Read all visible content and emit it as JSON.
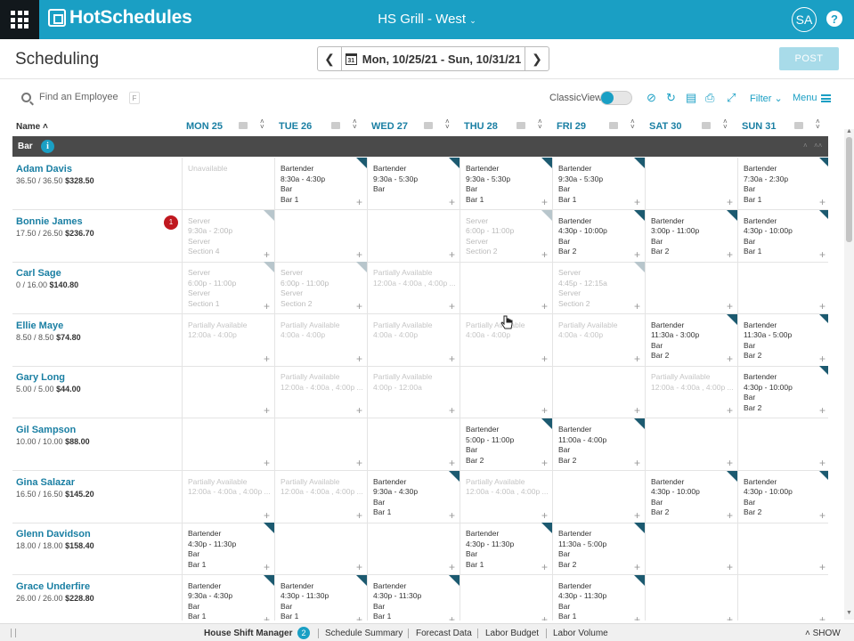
{
  "topbar": {
    "logo": "HotSchedules",
    "location": "HS Grill - West",
    "avatar": "SA",
    "help": "?"
  },
  "page": {
    "title": "Scheduling",
    "date_range": "Mon, 10/25/21 - Sun, 10/31/21",
    "calendar_day": "31",
    "post_label": "POST"
  },
  "toolbar": {
    "search_placeholder": "Find an Employee",
    "search_key": "F",
    "classic_view": "ClassicView",
    "filter": "Filter",
    "menu": "Menu"
  },
  "header": {
    "name": "Name",
    "days": [
      "MON 25",
      "TUE 26",
      "WED 27",
      "THU 28",
      "FRI 29",
      "SAT 30",
      "SUN 31"
    ]
  },
  "group": {
    "name": "Bar",
    "info": "i"
  },
  "employees": [
    {
      "name": "Adam Davis",
      "hours": "36.50 / 36.50",
      "wage": "$328.50",
      "alert": "",
      "cells": [
        {
          "kind": "unav",
          "lines": [
            "Unavailable"
          ]
        },
        {
          "kind": "shift",
          "lines": [
            "Bartender",
            "8:30a - 4:30p",
            "Bar",
            "Bar 1"
          ]
        },
        {
          "kind": "shift",
          "lines": [
            "Bartender",
            "9:30a - 5:30p",
            "Bar"
          ]
        },
        {
          "kind": "shift",
          "lines": [
            "Bartender",
            "9:30a - 5:30p",
            "Bar",
            "Bar 1"
          ]
        },
        {
          "kind": "shift",
          "lines": [
            "Bartender",
            "9:30a - 5:30p",
            "Bar",
            "Bar 1"
          ]
        },
        {
          "kind": "empty",
          "lines": []
        },
        {
          "kind": "shift",
          "lines": [
            "Bartender",
            "7:30a - 2:30p",
            "Bar",
            "Bar 1"
          ]
        }
      ]
    },
    {
      "name": "Bonnie James",
      "hours": "17.50 / 26.50",
      "wage": "$236.70",
      "alert": "1",
      "cells": [
        {
          "kind": "faint",
          "lines": [
            "Server",
            "9:30a - 2:00p",
            "Server",
            "Section 4"
          ]
        },
        {
          "kind": "empty",
          "lines": []
        },
        {
          "kind": "empty",
          "lines": []
        },
        {
          "kind": "faint",
          "lines": [
            "Server",
            "6:00p - 11:00p",
            "Server",
            "Section 2"
          ]
        },
        {
          "kind": "shift",
          "lines": [
            "Bartender",
            "4:30p - 10:00p",
            "Bar",
            "Bar 2"
          ]
        },
        {
          "kind": "shift",
          "lines": [
            "Bartender",
            "3:00p - 11:00p",
            "Bar",
            "Bar 2"
          ]
        },
        {
          "kind": "shift",
          "lines": [
            "Bartender",
            "4:30p - 10:00p",
            "Bar",
            "Bar 1"
          ]
        }
      ]
    },
    {
      "name": "Carl Sage",
      "hours": "0 / 16.00",
      "wage": "$140.80",
      "alert": "",
      "cells": [
        {
          "kind": "faint",
          "lines": [
            "Server",
            "6:00p - 11:00p",
            "Server",
            "Section 1"
          ]
        },
        {
          "kind": "faint",
          "lines": [
            "Server",
            "6:00p - 11:00p",
            "Server",
            "Section 2"
          ]
        },
        {
          "kind": "partial",
          "lines": [
            "Partially Available",
            "12:00a - 4:00a , 4:00p ..."
          ]
        },
        {
          "kind": "empty",
          "lines": []
        },
        {
          "kind": "faint",
          "lines": [
            "Server",
            "4:45p - 12:15a",
            "Server",
            "Section 2"
          ]
        },
        {
          "kind": "empty",
          "lines": []
        },
        {
          "kind": "empty",
          "lines": []
        }
      ]
    },
    {
      "name": "Ellie Maye",
      "hours": "8.50 / 8.50",
      "wage": "$74.80",
      "alert": "",
      "cells": [
        {
          "kind": "partial",
          "lines": [
            "Partially Available",
            "12:00a - 4:00p"
          ]
        },
        {
          "kind": "partial",
          "lines": [
            "Partially Available",
            "4:00a - 4:00p"
          ]
        },
        {
          "kind": "partial",
          "lines": [
            "Partially Available",
            "4:00a - 4:00p"
          ]
        },
        {
          "kind": "partial",
          "lines": [
            "Partially Available",
            "4:00a - 4:00p"
          ]
        },
        {
          "kind": "partial",
          "lines": [
            "Partially Available",
            "4:00a - 4:00p"
          ]
        },
        {
          "kind": "shift",
          "lines": [
            "Bartender",
            "11:30a - 3:00p",
            "Bar",
            "Bar 2"
          ]
        },
        {
          "kind": "shift",
          "lines": [
            "Bartender",
            "11:30a - 5:00p",
            "Bar",
            "Bar 2"
          ]
        }
      ]
    },
    {
      "name": "Gary Long",
      "hours": "5.00 / 5.00",
      "wage": "$44.00",
      "alert": "",
      "cells": [
        {
          "kind": "empty",
          "lines": []
        },
        {
          "kind": "partial",
          "lines": [
            "Partially Available",
            "12:00a - 4:00a , 4:00p ..."
          ]
        },
        {
          "kind": "partial",
          "lines": [
            "Partially Available",
            "4:00p - 12:00a"
          ]
        },
        {
          "kind": "empty",
          "lines": []
        },
        {
          "kind": "empty",
          "lines": []
        },
        {
          "kind": "partial",
          "lines": [
            "Partially Available",
            "12:00a - 4:00a , 4:00p ..."
          ]
        },
        {
          "kind": "shift",
          "lines": [
            "Bartender",
            "4:30p - 10:00p",
            "Bar",
            "Bar 2"
          ]
        }
      ]
    },
    {
      "name": "Gil Sampson",
      "hours": "10.00 / 10.00",
      "wage": "$88.00",
      "alert": "",
      "cells": [
        {
          "kind": "empty",
          "lines": []
        },
        {
          "kind": "empty",
          "lines": []
        },
        {
          "kind": "empty",
          "lines": []
        },
        {
          "kind": "shift",
          "lines": [
            "Bartender",
            "5:00p - 11:00p",
            "Bar",
            "Bar 2"
          ]
        },
        {
          "kind": "shift",
          "lines": [
            "Bartender",
            "11:00a - 4:00p",
            "Bar",
            "Bar 2"
          ]
        },
        {
          "kind": "empty",
          "lines": []
        },
        {
          "kind": "empty",
          "lines": []
        }
      ]
    },
    {
      "name": "Gina Salazar",
      "hours": "16.50 / 16.50",
      "wage": "$145.20",
      "alert": "",
      "cells": [
        {
          "kind": "partial",
          "lines": [
            "Partially Available",
            "12:00a - 4:00a , 4:00p ..."
          ]
        },
        {
          "kind": "partial",
          "lines": [
            "Partially Available",
            "12:00a - 4:00a , 4:00p ..."
          ]
        },
        {
          "kind": "shift",
          "lines": [
            "Bartender",
            "9:30a - 4:30p",
            "Bar",
            "Bar 1"
          ]
        },
        {
          "kind": "partial",
          "lines": [
            "Partially Available",
            "12:00a - 4:00a , 4:00p ..."
          ]
        },
        {
          "kind": "empty",
          "lines": []
        },
        {
          "kind": "shift",
          "lines": [
            "Bartender",
            "4:30p - 10:00p",
            "Bar",
            "Bar 2"
          ]
        },
        {
          "kind": "shift",
          "lines": [
            "Bartender",
            "4:30p - 10:00p",
            "Bar",
            "Bar 2"
          ]
        }
      ]
    },
    {
      "name": "Glenn Davidson",
      "hours": "18.00 / 18.00",
      "wage": "$158.40",
      "alert": "",
      "cells": [
        {
          "kind": "shift",
          "lines": [
            "Bartender",
            "4:30p - 11:30p",
            "Bar",
            "Bar 1"
          ]
        },
        {
          "kind": "empty",
          "lines": []
        },
        {
          "kind": "empty",
          "lines": []
        },
        {
          "kind": "shift",
          "lines": [
            "Bartender",
            "4:30p - 11:30p",
            "Bar",
            "Bar 1"
          ]
        },
        {
          "kind": "shift",
          "lines": [
            "Bartender",
            "11:30a - 5:00p",
            "Bar",
            "Bar 2"
          ]
        },
        {
          "kind": "empty",
          "lines": []
        },
        {
          "kind": "empty",
          "lines": []
        }
      ]
    },
    {
      "name": "Grace Underfire",
      "hours": "26.00 / 26.00",
      "wage": "$228.80",
      "alert": "",
      "cells": [
        {
          "kind": "shift",
          "lines": [
            "Bartender",
            "9:30a - 4:30p",
            "Bar",
            "Bar 1"
          ]
        },
        {
          "kind": "shift",
          "lines": [
            "Bartender",
            "4:30p - 11:30p",
            "Bar",
            "Bar 1"
          ]
        },
        {
          "kind": "shift",
          "lines": [
            "Bartender",
            "4:30p - 11:30p",
            "Bar",
            "Bar 1"
          ]
        },
        {
          "kind": "empty",
          "lines": []
        },
        {
          "kind": "shift",
          "lines": [
            "Bartender",
            "4:30p - 11:30p",
            "Bar",
            "Bar 1"
          ]
        },
        {
          "kind": "empty",
          "lines": []
        },
        {
          "kind": "empty",
          "lines": []
        }
      ]
    }
  ],
  "footer": {
    "tabs": [
      "House Shift Manager",
      "Schedule Summary",
      "Forecast Data",
      "Labor Budget",
      "Labor Volume"
    ],
    "badge": "2",
    "show": "SHOW"
  },
  "colors": {
    "accent": "#1a9fc4",
    "shift_marker": "#1c5a70",
    "alert": "#c0181f",
    "group_bar": "#4a4a4a"
  },
  "chart_data": {
    "type": "table",
    "title": "Scheduling",
    "columns": [
      "Name",
      "MON 25",
      "TUE 26",
      "WED 27",
      "THU 28",
      "FRI 29",
      "SAT 30",
      "SUN 31"
    ],
    "group": "Bar",
    "rows": [
      [
        "Adam Davis",
        "Unavailable",
        "Bartender 8:30a - 4:30p",
        "Bartender 9:30a - 5:30p",
        "Bartender 9:30a - 5:30p",
        "Bartender 9:30a - 5:30p",
        "",
        "Bartender 7:30a - 2:30p"
      ],
      [
        "Bonnie James",
        "Server 9:30a - 2:00p",
        "",
        "",
        "Server 6:00p - 11:00p",
        "Bartender 4:30p - 10:00p",
        "Bartender 3:00p - 11:00p",
        "Bartender 4:30p - 10:00p"
      ],
      [
        "Carl Sage",
        "Server 6:00p - 11:00p",
        "Server 6:00p - 11:00p",
        "Partially Available",
        "",
        "Server 4:45p - 12:15a",
        "",
        ""
      ],
      [
        "Ellie Maye",
        "Partially Available",
        "Partially Available",
        "Partially Available",
        "Partially Available",
        "Partially Available",
        "Bartender 11:30a - 3:00p",
        "Bartender 11:30a - 5:00p"
      ],
      [
        "Gary Long",
        "",
        "Partially Available",
        "Partially Available",
        "",
        "",
        "Partially Available",
        "Bartender 4:30p - 10:00p"
      ],
      [
        "Gil Sampson",
        "",
        "",
        "",
        "Bartender 5:00p - 11:00p",
        "Bartender 11:00a - 4:00p",
        "",
        ""
      ],
      [
        "Gina Salazar",
        "Partially Available",
        "Partially Available",
        "Bartender 9:30a - 4:30p",
        "Partially Available",
        "",
        "Bartender 4:30p - 10:00p",
        "Bartender 4:30p - 10:00p"
      ],
      [
        "Glenn Davidson",
        "Bartender 4:30p - 11:30p",
        "",
        "",
        "Bartender 4:30p - 11:30p",
        "Bartender 11:30a - 5:00p",
        "",
        ""
      ],
      [
        "Grace Underfire",
        "Bartender 9:30a - 4:30p",
        "Bartender 4:30p - 11:30p",
        "Bartender 4:30p - 11:30p",
        "",
        "Bartender 4:30p - 11:30p",
        "",
        ""
      ]
    ]
  }
}
